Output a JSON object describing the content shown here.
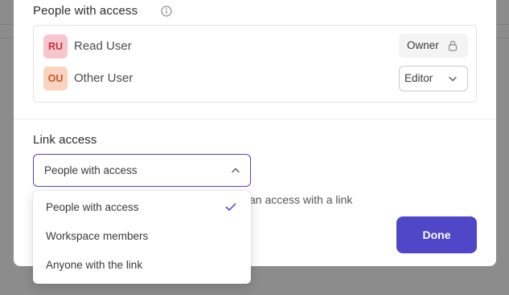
{
  "people_section": {
    "title": "People with access",
    "icon": "info-icon",
    "people": [
      {
        "initials": "RU",
        "name": "Read User",
        "role": "Owner",
        "role_icon": "lock-icon",
        "avatar_bg": "#f7c6cd",
        "avatar_fg": "#c43145"
      },
      {
        "initials": "OU",
        "name": "Other User",
        "role": "Editor",
        "role_icon": "chevron-down-icon",
        "avatar_bg": "#fbd3c0",
        "avatar_fg": "#c8552c"
      }
    ]
  },
  "link_section": {
    "title": "Link access",
    "selected": "People with access",
    "hint_visible": "an access with a link",
    "options": [
      {
        "label": "People with access",
        "selected": true
      },
      {
        "label": "Workspace members",
        "selected": false
      },
      {
        "label": "Anyone with the link",
        "selected": false
      }
    ]
  },
  "actions": {
    "done_label": "Done"
  },
  "colors": {
    "accent": "#4f46c8",
    "overlay": "#8c8c8c"
  }
}
